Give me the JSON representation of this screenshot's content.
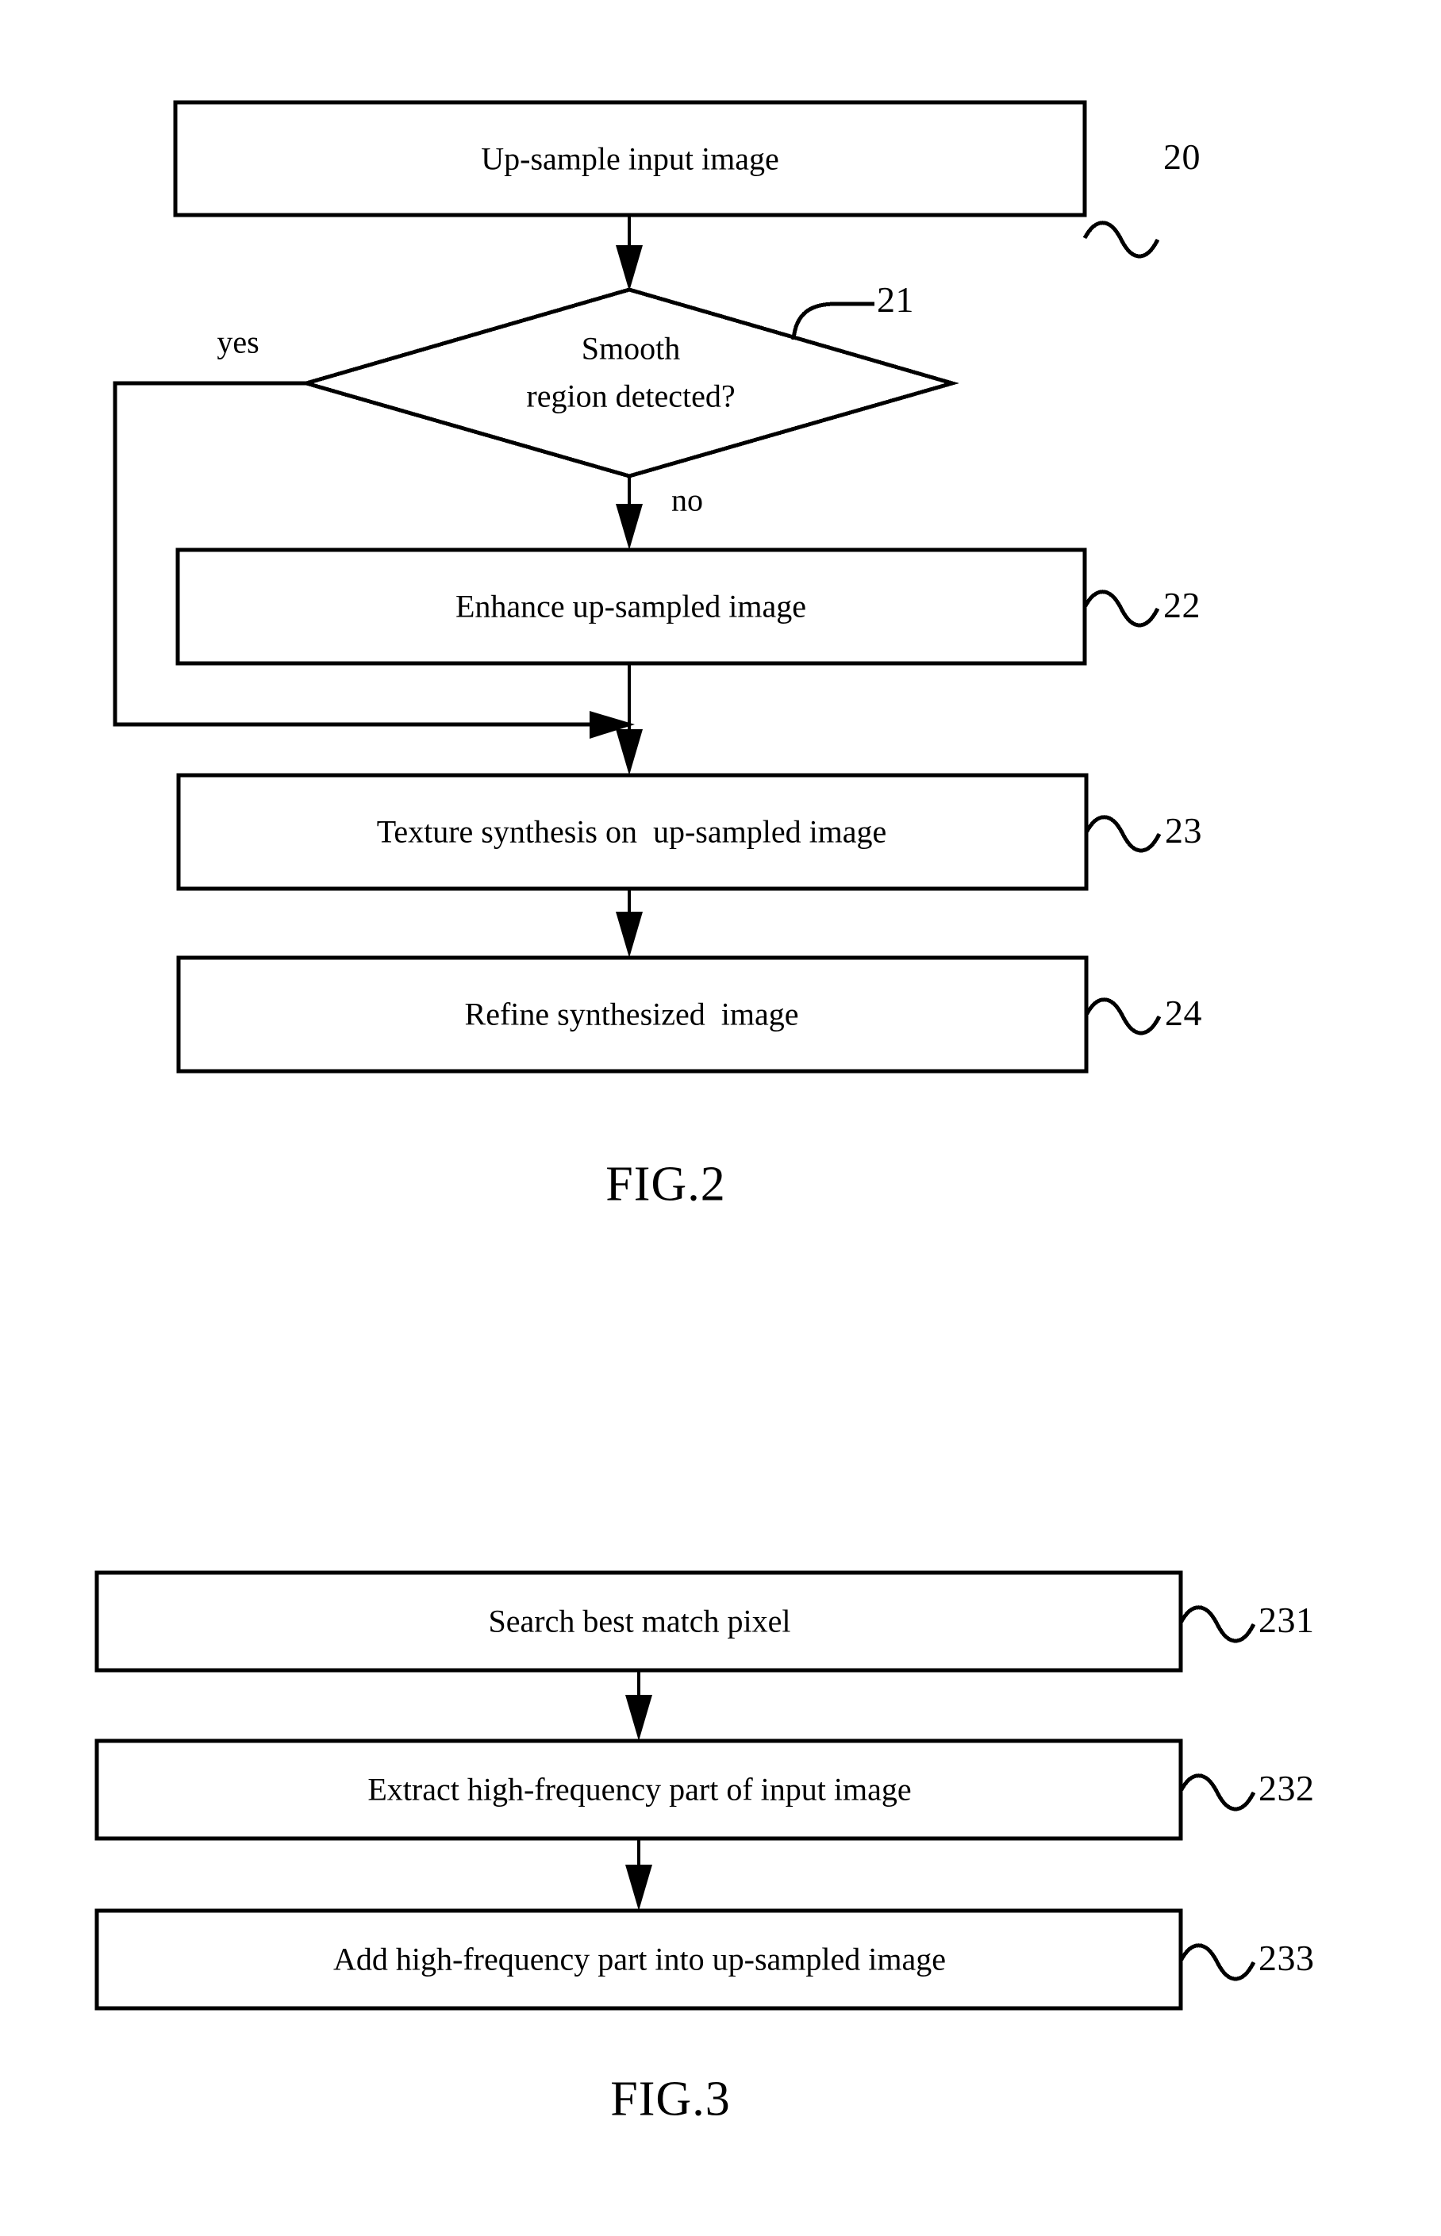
{
  "document": {
    "type": "patent-flowchart-sheet",
    "figures": [
      "FIG.2",
      "FIG.3"
    ]
  },
  "fig2": {
    "caption": "FIG.2",
    "steps": [
      {
        "id": "step-20",
        "label": "Up-sample input image",
        "ref": "20",
        "shape": "process"
      },
      {
        "id": "step-21",
        "label_line1": "Smooth",
        "label_line2": "region detected?",
        "ref": "21",
        "shape": "decision"
      },
      {
        "id": "step-22",
        "label": "Enhance up-sampled image",
        "ref": "22",
        "shape": "process"
      },
      {
        "id": "step-23",
        "label": "Texture synthesis on  up-sampled image",
        "ref": "23",
        "shape": "process"
      },
      {
        "id": "step-24",
        "label": "Refine synthesized  image",
        "ref": "24",
        "shape": "process"
      }
    ],
    "branches": {
      "yes": "yes",
      "no": "no"
    }
  },
  "fig3": {
    "caption": "FIG.3",
    "steps": [
      {
        "id": "step-231",
        "label": "Search best match pixel",
        "ref": "231",
        "shape": "process"
      },
      {
        "id": "step-232",
        "label": "Extract high-frequency part of input image",
        "ref": "232",
        "shape": "process"
      },
      {
        "id": "step-233",
        "label": "Add high-frequency part into up-sampled image",
        "ref": "233",
        "shape": "process"
      }
    ]
  },
  "colors": {
    "ink": "#000000",
    "paper": "#ffffff"
  }
}
